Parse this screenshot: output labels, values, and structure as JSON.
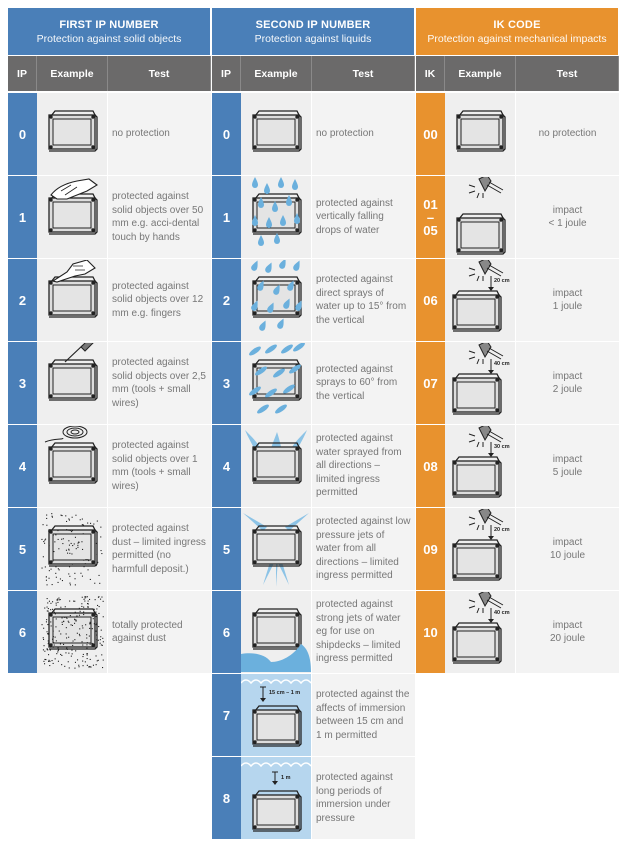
{
  "sections": [
    {
      "title": "FIRST IP NUMBER",
      "subtitle": "Protection against solid objects",
      "color": "#4a7fb8",
      "columns": [
        "IP",
        "Example",
        "Test"
      ],
      "rows": [
        {
          "code": "0",
          "icon": "enclosure-icon",
          "test": "no protection"
        },
        {
          "code": "1",
          "icon": "hand-touch-icon",
          "test": "protected against solid objects over 50 mm e.g. acci-dental touch by hands"
        },
        {
          "code": "2",
          "icon": "finger-touch-icon",
          "test": "protected against solid objects over 12 mm e.g. fingers"
        },
        {
          "code": "3",
          "icon": "screwdriver-tool-icon",
          "test": "protected against solid objects over 2,5 mm (tools + small wires)"
        },
        {
          "code": "4",
          "icon": "wire-coil-icon",
          "test": "protected against solid objects over 1 mm (tools + small wires)"
        },
        {
          "code": "5",
          "icon": "dust-limited-icon",
          "test": "protected against dust – limited ingress permitted (no harmfull deposit.)"
        },
        {
          "code": "6",
          "icon": "dust-heavy-icon",
          "test": "totally protected against dust"
        }
      ]
    },
    {
      "title": "SECOND IP NUMBER",
      "subtitle": "Protection against liquids",
      "color": "#4a7fb8",
      "columns": [
        "IP",
        "Example",
        "Test"
      ],
      "rows": [
        {
          "code": "0",
          "icon": "enclosure-icon",
          "test": "no protection"
        },
        {
          "code": "1",
          "icon": "vertical-drops-icon",
          "test": "protected against vertically falling drops of water"
        },
        {
          "code": "2",
          "icon": "angled-drops-15-icon",
          "test": "protected against direct sprays of water up to 15° from the vertical"
        },
        {
          "code": "3",
          "icon": "spray-60-icon",
          "test": "protected against sprays to 60° from the vertical"
        },
        {
          "code": "4",
          "icon": "splash-all-directions-icon",
          "test": "protected against water sprayed from all directions – limited ingress permitted"
        },
        {
          "code": "5",
          "icon": "low-pressure-jets-icon",
          "test": "protected against low pressure jets of water from all directions – limited ingress permitted"
        },
        {
          "code": "6",
          "icon": "strong-jets-wave-icon",
          "test": "protected against strong jets of water eg for use on shipdecks – limited ingress permitted"
        },
        {
          "code": "7",
          "icon": "immersion-icon",
          "depth_label": "15 cm – 1 m",
          "test": "protected against the affects of immersion between 15 cm and 1 m permitted"
        },
        {
          "code": "8",
          "icon": "deep-immersion-icon",
          "depth_label": "1 m",
          "test": "protected against long periods of immersion under pressure"
        }
      ]
    },
    {
      "title": "IK CODE",
      "subtitle": "Protection against mechanical impacts",
      "color": "#e8922e",
      "columns": [
        "IK",
        "Example",
        "Test"
      ],
      "rows": [
        {
          "code": "00",
          "icon": "enclosure-icon",
          "test": "no protection"
        },
        {
          "code": "01\n–\n05",
          "icon": "hammer-impact-icon",
          "test": "impact\n< 1 joule"
        },
        {
          "code": "06",
          "icon": "hammer-drop-icon",
          "drop_label": "20 cm",
          "test": "impact\n1 joule"
        },
        {
          "code": "07",
          "icon": "hammer-drop-icon",
          "drop_label": "40 cm",
          "test": "impact\n2  joule"
        },
        {
          "code": "08",
          "icon": "hammer-drop-icon",
          "drop_label": "30 cm",
          "test": "impact\n5 joule"
        },
        {
          "code": "09",
          "icon": "hammer-drop-icon",
          "drop_label": "20 cm",
          "test": "impact\n10 joule"
        },
        {
          "code": "10",
          "icon": "hammer-drop-icon",
          "drop_label": "40 cm",
          "test": "impact\n20 joule"
        }
      ]
    }
  ]
}
